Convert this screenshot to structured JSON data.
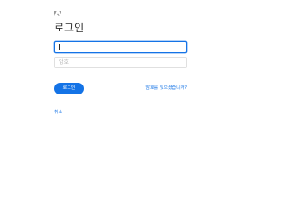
{
  "brand": {
    "logo_icon": "adobe-logo-icon"
  },
  "page": {
    "title": "로그인"
  },
  "form": {
    "email_value": "",
    "password_placeholder": "암호"
  },
  "actions": {
    "login_label": "로그인",
    "forgot_password_label": "암호를 잊으셨습니까?",
    "cancel_label": "취소"
  },
  "colors": {
    "accent": "#1473e6",
    "title_text": "#2c2c2c",
    "field_border": "#e0e0e0",
    "background": "#ffffff"
  }
}
